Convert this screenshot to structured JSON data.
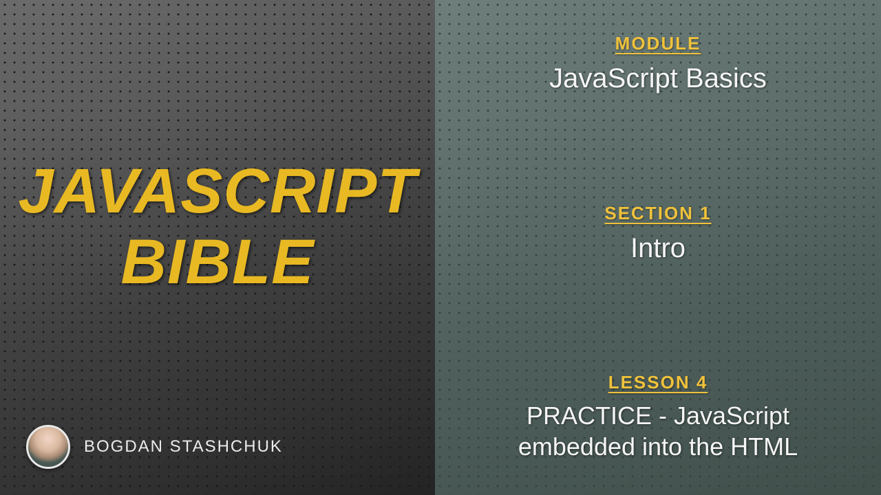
{
  "course": {
    "title_line1": "JAVASCRIPT",
    "title_line2": "BIBLE",
    "author_name": "BOGDAN STASHCHUK"
  },
  "module": {
    "label": "MODULE",
    "value": "JavaScript Basics"
  },
  "section": {
    "label": "SECTION 1",
    "value": "Intro"
  },
  "lesson": {
    "label": "LESSON 4",
    "value": "PRACTICE - JavaScript embedded into the HTML"
  },
  "colors": {
    "accent": "#e8b923",
    "label": "#f0c23b",
    "text_light": "#f5f5f5"
  }
}
